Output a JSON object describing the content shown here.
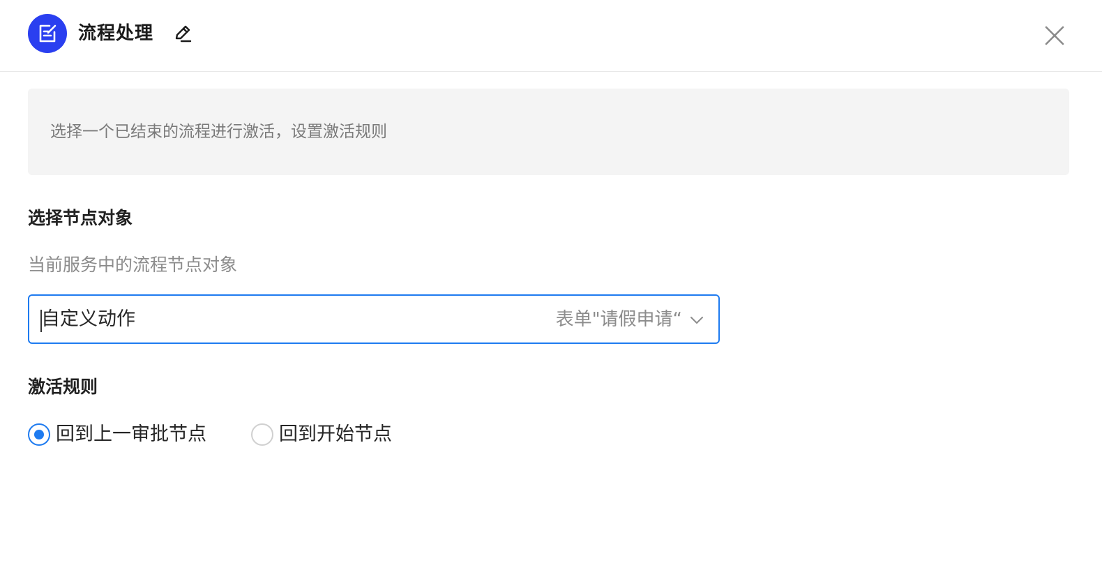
{
  "header": {
    "title": "流程处理",
    "app_icon": "form-edit-icon",
    "edit_icon": "pen-icon",
    "close_icon": "close-icon"
  },
  "banner": {
    "text": "选择一个已结束的流程进行激活，设置激活规则"
  },
  "node_section": {
    "title": "选择节点对象",
    "description": "当前服务中的流程节点对象",
    "select": {
      "value": "自定义动作",
      "hint": "表单\"请假申请“",
      "icon": "chevron-down-icon"
    }
  },
  "rule_section": {
    "title": "激活规则",
    "options": [
      {
        "label": "回到上一审批节点",
        "checked": true
      },
      {
        "label": "回到开始节点",
        "checked": false
      }
    ]
  },
  "colors": {
    "accent": "#1e7bf0",
    "icon_bg": "#2a3ff0",
    "banner_bg": "#f4f4f4"
  }
}
